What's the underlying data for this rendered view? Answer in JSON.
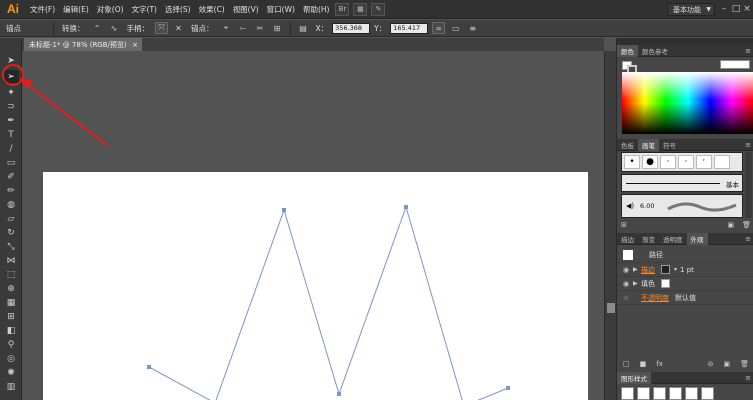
{
  "app": {
    "logo": "Ai",
    "menus": [
      "文件(F)",
      "编辑(E)",
      "对象(O)",
      "文字(T)",
      "选择(S)",
      "效果(C)",
      "视图(V)",
      "窗口(W)",
      "帮助(H)"
    ],
    "workspace": "基本功能"
  },
  "control_bar": {
    "anchor_label": "锚点",
    "convert_label": "转换：",
    "handle_label": "手柄：",
    "anchors_label": "锚点：",
    "x_label": "X：",
    "x_value": "356.368",
    "y_label": "Y：",
    "y_value": "165.417"
  },
  "document": {
    "tab_title": "未标题-1* @ 78% (RGB/预览)",
    "close": "×"
  },
  "panels": {
    "color": {
      "tabs": [
        "颜色",
        "颜色参考"
      ]
    },
    "brushes": {
      "tabs": [
        "色板",
        "画笔",
        "符号"
      ],
      "basic_label": "基本",
      "size_value": "6.00"
    },
    "appearance": {
      "tabs": [
        "描边",
        "渐变",
        "透明度",
        "外观"
      ],
      "object_type": "路径",
      "stroke_label": "描边",
      "stroke_value": "1 pt",
      "fill_label": "填色",
      "opacity_label": "不透明度",
      "opacity_value": "默认值"
    },
    "graphic_styles": {
      "tabs": [
        "图形样式"
      ]
    }
  },
  "colors": {
    "accent": "#ff8c2a",
    "annotation_red": "#e02020",
    "path_stroke": "#7f93c7"
  },
  "icons": {
    "selection": "selection-arrow-icon",
    "direct_selection": "direct-selection-icon"
  }
}
